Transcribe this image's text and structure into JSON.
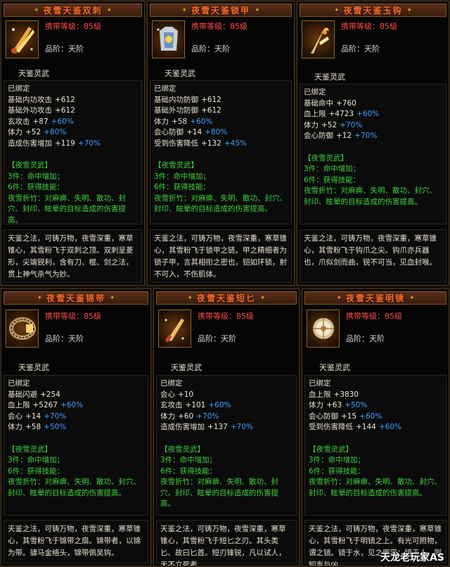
{
  "common": {
    "level_label": "携带等级：85级",
    "grade_label": "品阶：天阶",
    "category": "天鉴灵武",
    "bound": "已绑定",
    "set_title": "【夜雪灵武】",
    "set_3": "3件：命中增加；",
    "set_6": "6件：获得技能：",
    "set_desc": "夜雪折竹：对麻痹、失明、散功、封穴、封印、眩晕的目标造成的伤害提高。"
  },
  "cards": [
    {
      "title": "夜雪天鉴双刺",
      "icon": "twin-daggers-icon",
      "stats": [
        {
          "k": "基础内功攻击",
          "v": "+612",
          "b": ""
        },
        {
          "k": "基础外功攻击",
          "v": "+612",
          "b": ""
        },
        {
          "k": "玄攻击",
          "v": "+87",
          "b": "+60%"
        },
        {
          "k": "体力",
          "v": "+52",
          "b": "+80%"
        },
        {
          "k": "造成伤害增加",
          "v": "+119",
          "b": "+70%"
        }
      ],
      "lore": "天鉴之法，可铸万物，夜雪深重，寒草锥心，其雪粉飞于双刺之顶。双刺呈菱形，尖端锐利，含有刀、棍、剑之法，贯上神气杀气为妙。"
    },
    {
      "title": "夜雪天鉴锁甲",
      "icon": "armor-icon",
      "stats": [
        {
          "k": "基础内功防御",
          "v": "+612",
          "b": ""
        },
        {
          "k": "基础外功防御",
          "v": "+612",
          "b": ""
        },
        {
          "k": "体力",
          "v": "+58",
          "b": "+60%"
        },
        {
          "k": "会心防御",
          "v": "+14",
          "b": "+80%"
        },
        {
          "k": "受到伤害降低",
          "v": "+132",
          "b": "+45%"
        }
      ],
      "lore": "天鉴之法，可铸万物，夜雪深重，寒草锥心，其雪粉飞于锁甲之链。甲之精细者为锁子甲，言其相衔之密也，铠如环锁，射不可入，不伤肌体。"
    },
    {
      "title": "夜雪天鉴玉钩",
      "icon": "jade-hook-icon",
      "stats": [
        {
          "k": "基础命中",
          "v": "+760",
          "b": ""
        },
        {
          "k": "血上限",
          "v": "+4723",
          "b": "+60%"
        },
        {
          "k": "体力",
          "v": "+52",
          "b": "+70%"
        },
        {
          "k": "会心防御",
          "v": "+12",
          "b": "+70%"
        }
      ],
      "lore": "天鉴之法，可铸万物，夜雪深重，寒草锥心，其雪粉飞于钩爪之尖。钩爪亦兵器也，爪似剑而曲，锐不可当，见血封喉。"
    },
    {
      "title": "夜雪天鉴锦带",
      "icon": "belt-icon",
      "stats": [
        {
          "k": "基础闪避",
          "v": "+254",
          "b": ""
        },
        {
          "k": "血上限",
          "v": "+5267",
          "b": "+60%"
        },
        {
          "k": "会心",
          "v": "+14",
          "b": "+70%"
        },
        {
          "k": "体力",
          "v": "+58",
          "b": "+50%"
        }
      ],
      "lore": "天鉴之法，可铸万物，夜雪深重，寒草锥心，其雪粉飞于锦带之扇。锦带者，以锦为带。骕马金络头，锦带佩吴钩。"
    },
    {
      "title": "夜雪天鉴短匕",
      "icon": "short-dagger-icon",
      "stats": [
        {
          "k": "会心",
          "v": "+10",
          "b": ""
        },
        {
          "k": "玄攻击",
          "v": "+101",
          "b": "+60%"
        },
        {
          "k": "体力",
          "v": "+60",
          "b": "+70%"
        },
        {
          "k": "造成伤害增加",
          "v": "+137",
          "b": "+70%"
        }
      ],
      "lore": "天鉴之法，可铸万物，夜雪深重，寒草锥心，其雪粉飞于短匕之刃。其头类匕、故曰匕首。短刃锋锐，凡以试人，无不立死者。"
    },
    {
      "title": "夜雪天鉴明镜",
      "icon": "mirror-icon",
      "stats": [
        {
          "k": "血上限",
          "v": "+3830",
          "b": ""
        },
        {
          "k": "体力",
          "v": "+63",
          "b": "+50%"
        },
        {
          "k": "会心防御",
          "v": "+15",
          "b": "+60%"
        },
        {
          "k": "受到伤害降低",
          "v": "+144",
          "b": "+60%"
        }
      ],
      "lore": "天鉴之法，可铸万物，夜雪深重，寒草锥心，其雪粉飞于明镜之上。有光可照物，谓之镜。镜于水，见之面容；镜于人，则知吉与凶。"
    }
  ],
  "watermark": "天龙老玩家AS"
}
